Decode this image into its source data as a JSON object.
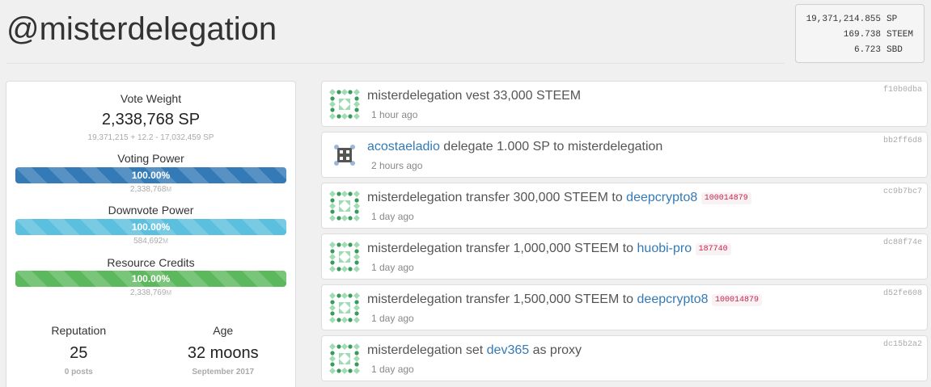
{
  "header": {
    "title": "@misterdelegation"
  },
  "balances": [
    {
      "amount": "19,371,214.855",
      "unit": "SP"
    },
    {
      "amount": "169.738",
      "unit": "STEEM"
    },
    {
      "amount": "6.723",
      "unit": "SBD"
    }
  ],
  "sidebar": {
    "vote_weight": {
      "label": "Vote Weight",
      "value": "2,338,768 SP",
      "breakdown": "19,371,215 + 12.2 - 17,032,459 SP"
    },
    "voting_power": {
      "label": "Voting Power",
      "percent_text": "100.00%",
      "fraction": 1.0,
      "sub_value": "2,338,768",
      "sub_unit": "M"
    },
    "downvote_power": {
      "label": "Downvote Power",
      "percent_text": "100.00%",
      "fraction": 1.0,
      "sub_value": "584,692",
      "sub_unit": "M"
    },
    "resource_credits": {
      "label": "Resource Credits",
      "percent_text": "100.00%",
      "fraction": 1.0,
      "sub_value": "2,338,769",
      "sub_unit": "M"
    },
    "reputation": {
      "label": "Reputation",
      "value": "25",
      "sub": "0 posts"
    },
    "age": {
      "label": "Age",
      "value": "32 moons",
      "sub": "September 2017"
    }
  },
  "feed": [
    {
      "avatar": "identicon-green",
      "parts": [
        {
          "t": "misterdelegation vest 33,000 STEEM",
          "link": false
        }
      ],
      "time": "1 hour ago",
      "hash": "f10b0dba"
    },
    {
      "avatar": "identicon-dice",
      "parts": [
        {
          "t": "acostaeladio",
          "link": true
        },
        {
          "t": " delegate 1.000 SP to misterdelegation",
          "link": false
        }
      ],
      "time": "2 hours ago",
      "hash": "bb2ff6d8"
    },
    {
      "avatar": "identicon-green",
      "parts": [
        {
          "t": "misterdelegation transfer 300,000 STEEM to ",
          "link": false
        },
        {
          "t": "deepcrypto8",
          "link": true
        }
      ],
      "tag": "100014879",
      "time": "1 day ago",
      "hash": "cc9b7bc7"
    },
    {
      "avatar": "identicon-green",
      "parts": [
        {
          "t": "misterdelegation transfer 1,000,000 STEEM to ",
          "link": false
        },
        {
          "t": "huobi-pro",
          "link": true
        }
      ],
      "tag": "187740",
      "time": "1 day ago",
      "hash": "dc88f74e"
    },
    {
      "avatar": "identicon-green",
      "parts": [
        {
          "t": "misterdelegation transfer 1,500,000 STEEM to ",
          "link": false
        },
        {
          "t": "deepcrypto8",
          "link": true
        }
      ],
      "tag": "100014879",
      "time": "1 day ago",
      "hash": "d52fe608"
    },
    {
      "avatar": "identicon-green",
      "parts": [
        {
          "t": "misterdelegation set ",
          "link": false
        },
        {
          "t": "dev365",
          "link": true
        },
        {
          "t": " as proxy",
          "link": false
        }
      ],
      "time": "1 day ago",
      "hash": "dc15b2a2"
    }
  ],
  "colors": {
    "link": "#337ab7",
    "voting_bar": "#337ab7",
    "downvote_bar": "#5bc0de",
    "rc_bar": "#5cb85c",
    "identicon_green": "#3a9a5c",
    "identicon_light": "#9fdcb4"
  }
}
